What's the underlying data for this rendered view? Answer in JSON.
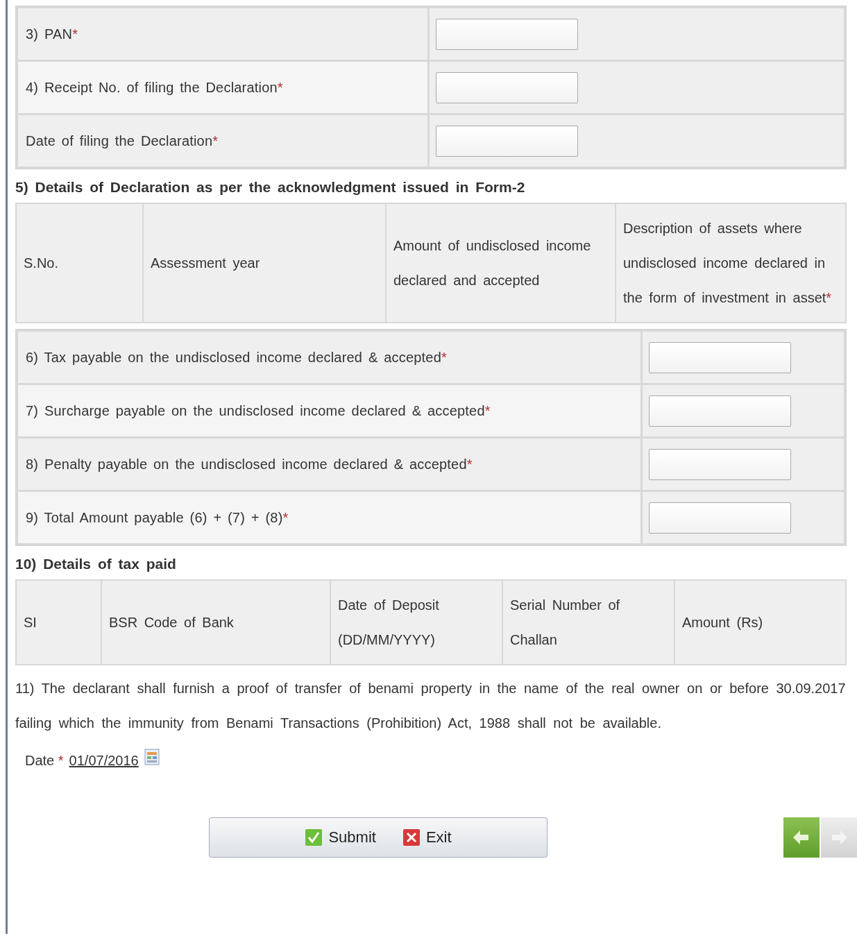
{
  "identity_rows": [
    {
      "label": "3) PAN",
      "mark": "*"
    },
    {
      "label": "4) Receipt No. of filing the Declaration",
      "mark": "*"
    },
    {
      "label": "Date of filing the Declaration",
      "mark": "*"
    }
  ],
  "declaration_section": {
    "heading": "5) Details of Declaration as per the acknowledgment issued in Form-2",
    "columns": [
      {
        "label": "S.No."
      },
      {
        "label": "Assessment year"
      },
      {
        "label": "Amount of undisclosed income declared and accepted"
      },
      {
        "label": "Description of assets where undisclosed income declared in the form of investment in asset",
        "mark": "*"
      }
    ]
  },
  "payable_rows": [
    {
      "label": "6) Tax payable on the undisclosed income declared & accepted",
      "mark": "*"
    },
    {
      "label": "7) Surcharge payable on the undisclosed income declared & accepted",
      "mark": "*"
    },
    {
      "label": "8) Penalty payable on the undisclosed income declared & accepted",
      "mark": "*"
    },
    {
      "label": "9) Total Amount payable (6) + (7) + (8)",
      "mark": "*"
    }
  ],
  "tax_paid_section": {
    "heading": "10) Details of tax paid",
    "columns": [
      {
        "label": "SI"
      },
      {
        "label": "BSR Code of Bank"
      },
      {
        "label": "Date of Deposit (DD/MM/YYYY)"
      },
      {
        "label": "Serial Number of Challan"
      },
      {
        "label": "Amount (Rs)"
      }
    ]
  },
  "note": "11) The declarant shall furnish a proof of transfer of benami property in the name of the real owner on or before 30.09.2017 failing which the immunity from Benami Transactions (Prohibition) Act, 1988 shall not be available.",
  "date_field": {
    "label": "Date",
    "mark": "*",
    "value": "01/07/2016"
  },
  "buttons": [
    {
      "label": "Submit",
      "kind": "submit"
    },
    {
      "label": "Exit",
      "kind": "exit"
    }
  ],
  "nav": [
    {
      "kind": "back",
      "disabled": false
    },
    {
      "kind": "next",
      "disabled": true
    }
  ]
}
